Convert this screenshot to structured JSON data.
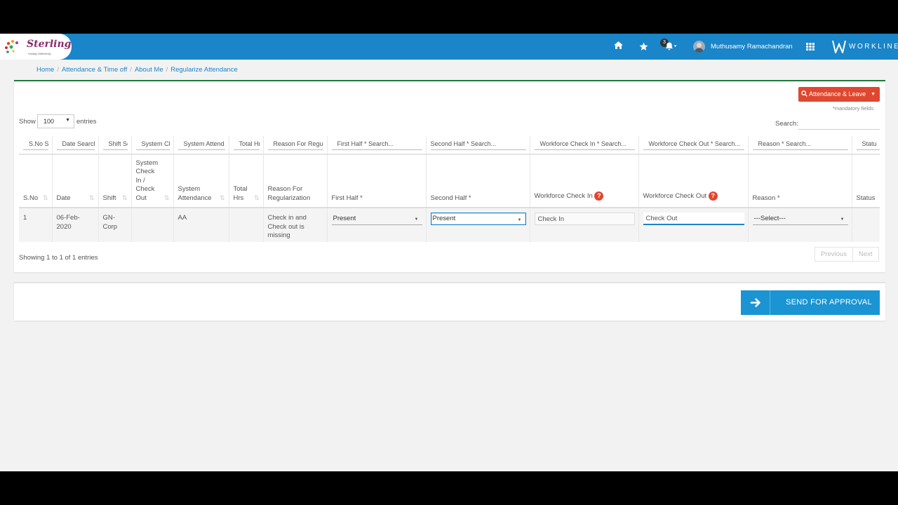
{
  "header": {
    "brand": "Sterling",
    "tagline": "Holiday Differently",
    "notification_count": "3",
    "user_name": "Muthusamy Ramachandran",
    "product_name": "WORKLINE",
    "bar_color": "#1a85c8"
  },
  "breadcrumb": [
    "Home",
    "Attendance & Time off",
    "About Me",
    "Regularize Attendance"
  ],
  "toolbar": {
    "attendance_leave_label": "Attendance & Leave",
    "mandatory_note": "mandatory fields",
    "mandatory_star": "*",
    "show_label": "Show",
    "entries_value": "100",
    "entries_label": "entries",
    "search_label": "Search:"
  },
  "table": {
    "filters": [
      "S.No Se",
      "Date Search",
      "Shift Se",
      "System Ch",
      "System Attend",
      "Total Hr",
      "Reason For Regul",
      "First Half    * Search...",
      "Second Half * Search...",
      "Workforce Check In *  Search...",
      "Workforce Check Out * Search...",
      "Reason *  Search...",
      "Statu"
    ],
    "headers": [
      "S.No",
      "Date",
      "Shift",
      "System Check In / Check Out",
      "System Attendance",
      "Total Hrs",
      "Reason For Regularization",
      "First Half *",
      "Second Half *",
      "Workforce Check In",
      "Workforce Check Out",
      "Reason *",
      "Status"
    ],
    "help_glyph": "?",
    "row": {
      "sno": "1",
      "date": "06-Feb-2020",
      "shift": "GN-Corp",
      "system_check": "",
      "system_attendance": "AA",
      "total_hrs": "",
      "reason_for_regularization": "Check in and Check out is missing",
      "first_half": "Present",
      "second_half": "Present",
      "check_in_placeholder": "Check In",
      "check_out_placeholder": "Check Out",
      "reason": "---Select---",
      "status": ""
    }
  },
  "footer": {
    "showing": "Showing 1 to 1 of 1 entries",
    "previous": "Previous",
    "next": "Next"
  },
  "actions": {
    "send_label": "SEND FOR APPROVAL",
    "accent": "#1a94d2",
    "danger": "#e0472f"
  }
}
